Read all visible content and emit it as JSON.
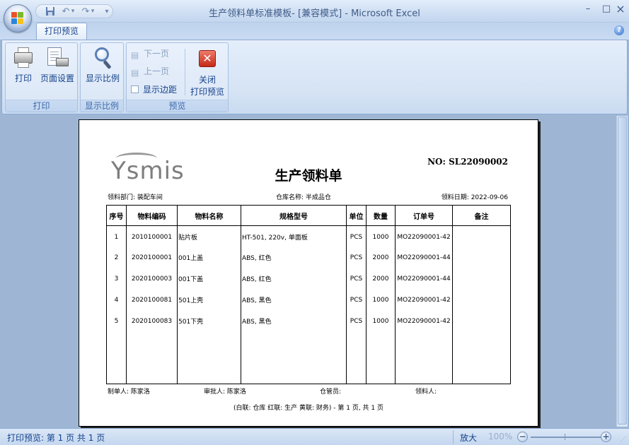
{
  "window": {
    "title": "生产领料单标准模板-  [兼容模式]  - Microsoft Excel",
    "minimize_glyph": "–",
    "restore_glyph": "□",
    "close_glyph": "×"
  },
  "qat": {
    "save_icon": "save-icon",
    "undo_icon": "undo-icon",
    "redo_icon": "redo-icon",
    "customize_icon": "customize-qat-icon"
  },
  "tabs": [
    {
      "label": "打印预览",
      "active": true
    }
  ],
  "help_glyph": "?",
  "ribbon": {
    "print_group": {
      "label": "打印",
      "print_button": "打印",
      "page_setup_button": "页面设置"
    },
    "zoom_group": {
      "label": "显示比例",
      "zoom_button": "显示比例"
    },
    "preview_group": {
      "label": "预览",
      "next_page": "下一页",
      "prev_page": "上一页",
      "show_margins": "显示边距",
      "close_line1": "关闭",
      "close_line2": "打印预览"
    }
  },
  "document": {
    "logo_text": "Ysmis",
    "title": "生产领料单",
    "number": "NO: SL22090002",
    "department": "领料部门: 装配车间",
    "warehouse": "仓库名称: 半成品仓",
    "date": "领料日期: 2022-09-06",
    "columns": [
      "序号",
      "物料编码",
      "物料名称",
      "规格型号",
      "单位",
      "数量",
      "订单号",
      "备注"
    ],
    "rows": [
      [
        "1",
        "2010100001",
        "贴片板",
        "HT-501, 220v, 单面板",
        "PCS",
        "1000",
        "MO22090001-42",
        ""
      ],
      [
        "2",
        "2020100001",
        "001上盖",
        "ABS, 红色",
        "PCS",
        "2000",
        "MO22090001-44",
        ""
      ],
      [
        "3",
        "2020100003",
        "001下盖",
        "ABS, 红色",
        "PCS",
        "2000",
        "MO22090001-44",
        ""
      ],
      [
        "4",
        "2020100081",
        "501上壳",
        "ABS, 黑色",
        "PCS",
        "1000",
        "MO22090001-42",
        ""
      ],
      [
        "5",
        "2020100083",
        "501下壳",
        "ABS, 黑色",
        "PCS",
        "1000",
        "MO22090001-42",
        ""
      ]
    ],
    "maker": "制单人: 陈家洛",
    "approver": "审批人: 陈家洛",
    "keeper": "仓管员:",
    "receiver": "领料人:",
    "footer": "(白联: 仓库  红联: 生产  黄联: 财务) - 第 1 页, 共 1 页"
  },
  "statusbar": {
    "status": "打印预览: 第 1 页  共 1 页",
    "zoom_label": "放大",
    "zoom_percent": "100%",
    "zoom_out": "−",
    "zoom_in": "+"
  },
  "colors": {
    "ribbon_text": "#15428b",
    "workspace_bg": "#9eb6d4",
    "close_red": "#c42a17"
  }
}
